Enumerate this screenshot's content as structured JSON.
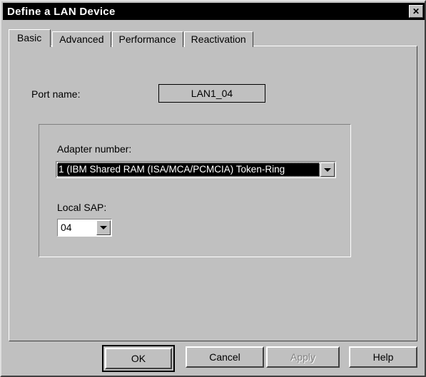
{
  "window": {
    "title": "Define a LAN Device",
    "close_label": "✕",
    "close_icon": "close-icon"
  },
  "tabs": [
    {
      "label": "Basic",
      "active": true
    },
    {
      "label": "Advanced",
      "active": false
    },
    {
      "label": "Performance",
      "active": false
    },
    {
      "label": "Reactivation",
      "active": false
    }
  ],
  "basic_panel": {
    "port_name": {
      "label": "Port name:",
      "value": "LAN1_04"
    },
    "adapter": {
      "label": "Adapter number:",
      "value": "1 (IBM Shared RAM (ISA/MCA/PCMCIA) Token-Ring",
      "selected": true
    },
    "local_sap": {
      "label": "Local SAP:",
      "value": "04"
    }
  },
  "buttons": {
    "ok": "OK",
    "cancel": "Cancel",
    "apply": "Apply",
    "help": "Help",
    "apply_disabled": true
  },
  "colors": {
    "face": "#c0c0c0",
    "titlebar": "#000000",
    "titlebar_text": "#ffffff",
    "highlight_bg": "#000000",
    "highlight_text": "#ffffff",
    "disabled_text": "#808080"
  }
}
